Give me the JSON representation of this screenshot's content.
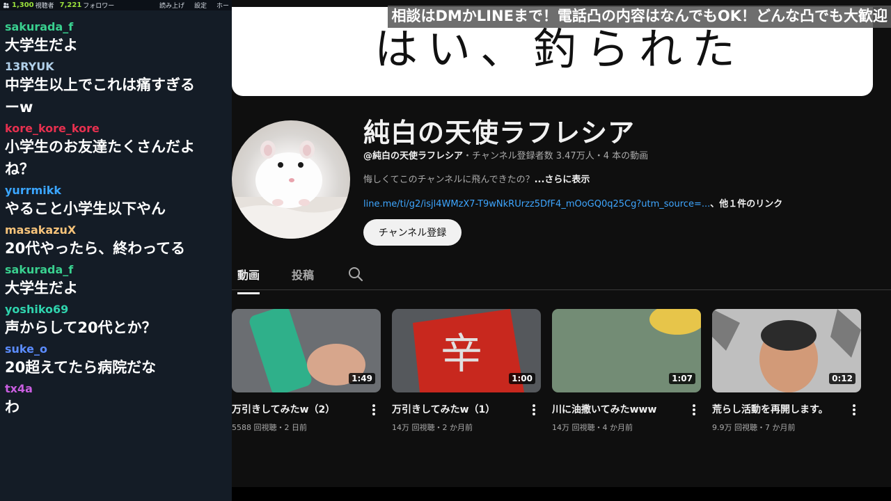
{
  "chat": {
    "topbar": {
      "viewer_count": "1,300",
      "viewer_label": "視聴者",
      "follower_count": "7,221",
      "follower_label": "フォロワー",
      "read_aloud": "読み上げ",
      "settings": "設定",
      "home": "ホー"
    },
    "messages": [
      {
        "user": "sakurada_f",
        "color": "#39d08f",
        "text": "大学生だよ"
      },
      {
        "user": "13RYUK",
        "color": "#b0cfe8",
        "text": "中学生以上でこれは痛すぎる\nーw"
      },
      {
        "user": "kore_kore_kore",
        "color": "#e6304f",
        "text": "小学生のお友達たくさんだよ\nね？"
      },
      {
        "user": "yurrmikk",
        "color": "#3ba6ff",
        "text": "やること小学生以下やん"
      },
      {
        "user": "masakazuX",
        "color": "#f6c37a",
        "text": "20代やったら、終わってる"
      },
      {
        "user": "sakurada_f",
        "color": "#39d08f",
        "text": "大学生だよ"
      },
      {
        "user": "yoshiko69",
        "color": "#2fd3ad",
        "text": "声からして20代とか？"
      },
      {
        "user": "suke_o",
        "color": "#5b8cff",
        "text": "20超えてたら病院だな"
      },
      {
        "user": "tx4a",
        "color": "#c95ee0",
        "text": "わ"
      }
    ]
  },
  "overlay": {
    "caption": "相談はDMかLINEまで！電話凸の内容はなんでもOK！どんな凸でも大歓迎"
  },
  "channel": {
    "banner_text": "はい、釣られた",
    "name": "純白の天使ラフレシア",
    "handle": "@純白の天使ラフレシア",
    "meta": "・チャンネル登録者数 3.47万人・4 本の動画",
    "description": "悔しくてこのチャンネルに飛んできたの？",
    "description_more": "...さらに表示",
    "link_url": "line.me/ti/g2/isjl4WMzX7-T9wNkRUrzz5DfF4_mOoGQ0q25Cg?utm_source=...",
    "link_others": "、他１件のリンク",
    "subscribe_label": "チャンネル登録",
    "avatar_icon": "hamster-avatar"
  },
  "tabs": {
    "videos": "動画",
    "posts": "投稿",
    "search_icon": "search-icon"
  },
  "videos": [
    {
      "title": "万引きしてみたw（2）",
      "meta": "5588 回視聴・2 日前",
      "duration": "1:49",
      "thumb_colors": [
        "#6b6e72",
        "#2fb08a",
        "#d7a68c"
      ]
    },
    {
      "title": "万引きしてみたw（1）",
      "meta": "14万 回視聴・2 か月前",
      "duration": "1:00",
      "thumb_colors": [
        "#55585c",
        "#c8281e",
        "#e0e0e0"
      ]
    },
    {
      "title": "川に油撒いてみたwww",
      "meta": "14万 回視聴・4 か月前",
      "duration": "1:07",
      "thumb_colors": [
        "#5d7a5c",
        "#e7c54a",
        "#9db0a4"
      ]
    },
    {
      "title": "荒らし活動を再開します。",
      "meta": "9.9万 回視聴・7 か月前",
      "duration": "0:12",
      "thumb_colors": [
        "#bfbfbf",
        "#d29a78",
        "#2b2b2b"
      ]
    }
  ]
}
